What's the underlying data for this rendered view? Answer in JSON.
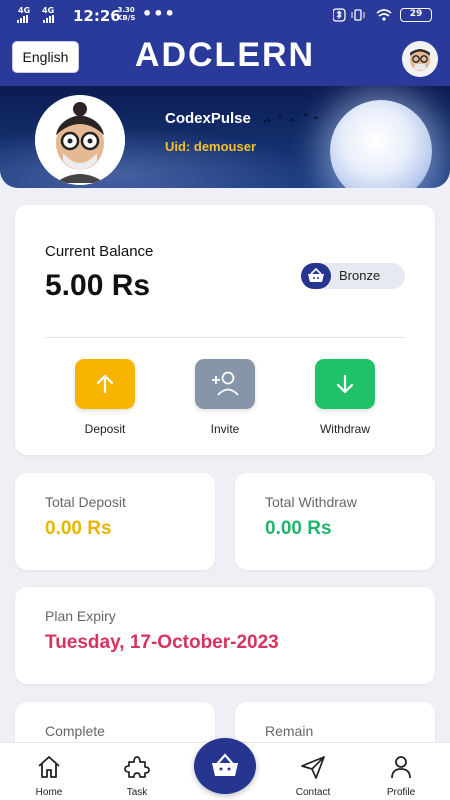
{
  "status_bar": {
    "signal_1": "4G",
    "signal_2": "4G",
    "time": "12:26",
    "speed_value": "3.30",
    "speed_unit": "KB/S",
    "dots": "•••",
    "battery": "29"
  },
  "header": {
    "language_button": "English",
    "app_title": "ADCLERN"
  },
  "profile_banner": {
    "username": "CodexPulse",
    "uid": "Uid: demouser"
  },
  "balance_card": {
    "label": "Current Balance",
    "value": "5.00 Rs",
    "tier": "Bronze",
    "actions": [
      {
        "label": "Deposit",
        "color": "#f7b500"
      },
      {
        "label": "Invite",
        "color": "#8795a8"
      },
      {
        "label": "Withdraw",
        "color": "#1fc169"
      }
    ]
  },
  "stats": {
    "total_deposit_label": "Total Deposit",
    "total_deposit_value": "0.00 Rs",
    "total_withdraw_label": "Total Withdraw",
    "total_withdraw_value": "0.00 Rs",
    "plan_expiry_label": "Plan Expiry",
    "plan_expiry_value": "Tuesday, 17-October-2023",
    "complete_label": "Complete",
    "remain_label": "Remain"
  },
  "colors": {
    "primary": "#26358f",
    "deposit_value": "#e8b400",
    "withdraw_value": "#1fb56a",
    "expiry_value": "#d8325f"
  },
  "bottom_nav": {
    "items": [
      {
        "label": "Home",
        "icon": "home-icon"
      },
      {
        "label": "Task",
        "icon": "puzzle-icon"
      },
      {
        "label": "Contact",
        "icon": "send-icon"
      },
      {
        "label": "Profile",
        "icon": "user-icon"
      }
    ],
    "center_icon": "basket-icon"
  }
}
